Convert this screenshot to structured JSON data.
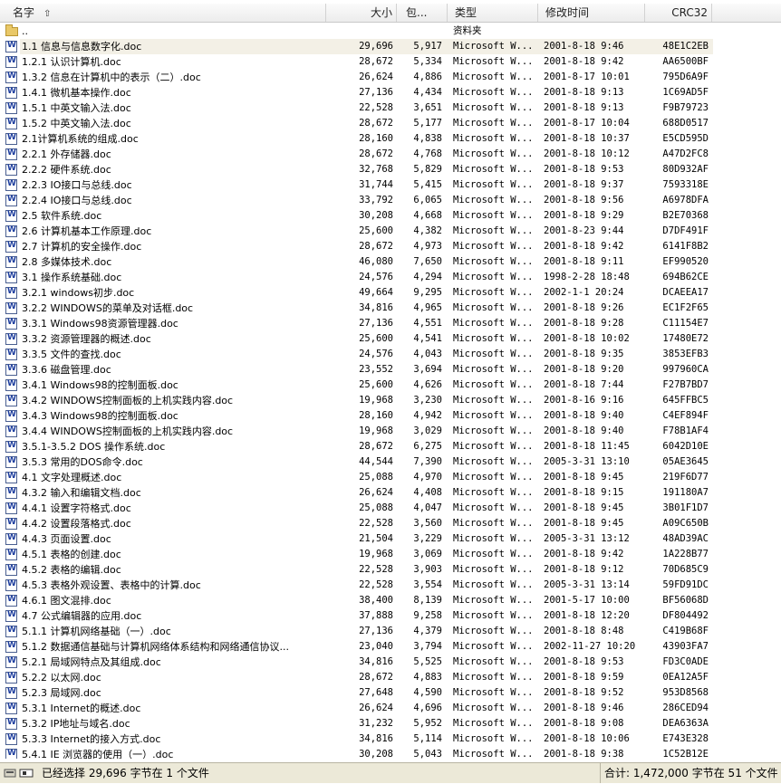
{
  "columns": {
    "name": "名字",
    "size": "大小",
    "packed": "包...",
    "type": "类型",
    "modified": "修改时间",
    "crc": "CRC32"
  },
  "parent_row": {
    "name": "..",
    "type": "资料夹"
  },
  "files": [
    {
      "name": "1.1 信息与信息数字化.doc",
      "size": "29,696",
      "packed": "5,917",
      "type": "Microsoft W...",
      "modified": "2001-8-18 9:46",
      "crc": "48E1C2EB",
      "selected": true
    },
    {
      "name": "1.2.1 认识计算机.doc",
      "size": "28,672",
      "packed": "5,334",
      "type": "Microsoft W...",
      "modified": "2001-8-18 9:42",
      "crc": "AA6500BF"
    },
    {
      "name": "1.3.2 信息在计算机中的表示（二）.doc",
      "size": "26,624",
      "packed": "4,886",
      "type": "Microsoft W...",
      "modified": "2001-8-17 10:01",
      "crc": "795D6A9F"
    },
    {
      "name": "1.4.1 微机基本操作.doc",
      "size": "27,136",
      "packed": "4,434",
      "type": "Microsoft W...",
      "modified": "2001-8-18 9:13",
      "crc": "1C69AD5F"
    },
    {
      "name": "1.5.1 中英文输入法.doc",
      "size": "22,528",
      "packed": "3,651",
      "type": "Microsoft W...",
      "modified": "2001-8-18 9:13",
      "crc": "F9B79723"
    },
    {
      "name": "1.5.2 中英文输入法.doc",
      "size": "28,672",
      "packed": "5,177",
      "type": "Microsoft W...",
      "modified": "2001-8-17 10:04",
      "crc": "688D0517"
    },
    {
      "name": "2.1计算机系统的组成.doc",
      "size": "28,160",
      "packed": "4,838",
      "type": "Microsoft W...",
      "modified": "2001-8-18 10:37",
      "crc": "E5CD595D"
    },
    {
      "name": "2.2.1 外存储器.doc",
      "size": "28,672",
      "packed": "4,768",
      "type": "Microsoft W...",
      "modified": "2001-8-18 10:12",
      "crc": "A47D2FC8"
    },
    {
      "name": "2.2.2 硬件系统.doc",
      "size": "32,768",
      "packed": "5,829",
      "type": "Microsoft W...",
      "modified": "2001-8-18 9:53",
      "crc": "80D932AF"
    },
    {
      "name": "2.2.3 IO接口与总线.doc",
      "size": "31,744",
      "packed": "5,415",
      "type": "Microsoft W...",
      "modified": "2001-8-18 9:37",
      "crc": "7593318E"
    },
    {
      "name": "2.2.4 IO接口与总线.doc",
      "size": "33,792",
      "packed": "6,065",
      "type": "Microsoft W...",
      "modified": "2001-8-18 9:56",
      "crc": "A6978DFA"
    },
    {
      "name": "2.5 软件系统.doc",
      "size": "30,208",
      "packed": "4,668",
      "type": "Microsoft W...",
      "modified": "2001-8-18 9:29",
      "crc": "B2E70368"
    },
    {
      "name": "2.6 计算机基本工作原理.doc",
      "size": "25,600",
      "packed": "4,382",
      "type": "Microsoft W...",
      "modified": "2001-8-23 9:44",
      "crc": "D7DF491F"
    },
    {
      "name": "2.7 计算机的安全操作.doc",
      "size": "28,672",
      "packed": "4,973",
      "type": "Microsoft W...",
      "modified": "2001-8-18 9:42",
      "crc": "6141F8B2"
    },
    {
      "name": "2.8 多媒体技术.doc",
      "size": "46,080",
      "packed": "7,650",
      "type": "Microsoft W...",
      "modified": "2001-8-18 9:11",
      "crc": "EF990520"
    },
    {
      "name": "3.1 操作系统基础.doc",
      "size": "24,576",
      "packed": "4,294",
      "type": "Microsoft W...",
      "modified": "1998-2-28 18:48",
      "crc": "694B62CE"
    },
    {
      "name": "3.2.1 windows初步.doc",
      "size": "49,664",
      "packed": "9,295",
      "type": "Microsoft W...",
      "modified": "2002-1-1 20:24",
      "crc": "DCAEEA17"
    },
    {
      "name": "3.2.2 WINDOWS的菜单及对话框.doc",
      "size": "34,816",
      "packed": "4,965",
      "type": "Microsoft W...",
      "modified": "2001-8-18 9:26",
      "crc": "EC1F2F65"
    },
    {
      "name": "3.3.1 Windows98资源管理器.doc",
      "size": "27,136",
      "packed": "4,551",
      "type": "Microsoft W...",
      "modified": "2001-8-18 9:28",
      "crc": "C11154E7"
    },
    {
      "name": "3.3.2 资源管理器的概述.doc",
      "size": "25,600",
      "packed": "4,541",
      "type": "Microsoft W...",
      "modified": "2001-8-18 10:02",
      "crc": "17480E72"
    },
    {
      "name": "3.3.5 文件的查找.doc",
      "size": "24,576",
      "packed": "4,043",
      "type": "Microsoft W...",
      "modified": "2001-8-18 9:35",
      "crc": "3853EFB3"
    },
    {
      "name": "3.3.6 磁盘管理.doc",
      "size": "23,552",
      "packed": "3,694",
      "type": "Microsoft W...",
      "modified": "2001-8-18 9:20",
      "crc": "997960CA"
    },
    {
      "name": "3.4.1 Windows98的控制面板.doc",
      "size": "25,600",
      "packed": "4,626",
      "type": "Microsoft W...",
      "modified": "2001-8-18 7:44",
      "crc": "F27B7BD7"
    },
    {
      "name": "3.4.2 WINDOWS控制面板的上机实践内容.doc",
      "size": "19,968",
      "packed": "3,230",
      "type": "Microsoft W...",
      "modified": "2001-8-16 9:16",
      "crc": "645FFBC5"
    },
    {
      "name": "3.4.3 Windows98的控制面板.doc",
      "size": "28,160",
      "packed": "4,942",
      "type": "Microsoft W...",
      "modified": "2001-8-18 9:40",
      "crc": "C4EF894F"
    },
    {
      "name": "3.4.4  WINDOWS控制面板的上机实践内容.doc",
      "size": "19,968",
      "packed": "3,029",
      "type": "Microsoft W...",
      "modified": "2001-8-18 9:40",
      "crc": "F78B1AF4"
    },
    {
      "name": "3.5.1-3.5.2  DOS 操作系统.doc",
      "size": "28,672",
      "packed": "6,275",
      "type": "Microsoft W...",
      "modified": "2001-8-18 11:45",
      "crc": "6042D10E"
    },
    {
      "name": "3.5.3 常用的DOS命令.doc",
      "size": "44,544",
      "packed": "7,390",
      "type": "Microsoft W...",
      "modified": "2005-3-31 13:10",
      "crc": "05AE3645"
    },
    {
      "name": "4.1 文字处理概述.doc",
      "size": "25,088",
      "packed": "4,970",
      "type": "Microsoft W...",
      "modified": "2001-8-18 9:45",
      "crc": "219F6D77"
    },
    {
      "name": "4.3.2 输入和编辑文档.doc",
      "size": "26,624",
      "packed": "4,408",
      "type": "Microsoft W...",
      "modified": "2001-8-18 9:15",
      "crc": "191180A7"
    },
    {
      "name": "4.4.1 设置字符格式.doc",
      "size": "25,088",
      "packed": "4,047",
      "type": "Microsoft W...",
      "modified": "2001-8-18 9:45",
      "crc": "3B01F1D7"
    },
    {
      "name": "4.4.2 设置段落格式.doc",
      "size": "22,528",
      "packed": "3,560",
      "type": "Microsoft W...",
      "modified": "2001-8-18 9:45",
      "crc": "A09C650B"
    },
    {
      "name": "4.4.3 页面设置.doc",
      "size": "21,504",
      "packed": "3,229",
      "type": "Microsoft W...",
      "modified": "2005-3-31 13:12",
      "crc": "48AD39AC"
    },
    {
      "name": "4.5.1 表格的创建.doc",
      "size": "19,968",
      "packed": "3,069",
      "type": "Microsoft W...",
      "modified": "2001-8-18 9:42",
      "crc": "1A228B77"
    },
    {
      "name": "4.5.2 表格的编辑.doc",
      "size": "22,528",
      "packed": "3,903",
      "type": "Microsoft W...",
      "modified": "2001-8-18 9:12",
      "crc": "70D685C9"
    },
    {
      "name": "4.5.3 表格外观设置、表格中的计算.doc",
      "size": "22,528",
      "packed": "3,554",
      "type": "Microsoft W...",
      "modified": "2005-3-31 13:14",
      "crc": "59FD91DC"
    },
    {
      "name": "4.6.1 图文混排.doc",
      "size": "38,400",
      "packed": "8,139",
      "type": "Microsoft W...",
      "modified": "2001-5-17 10:00",
      "crc": "BF56068D"
    },
    {
      "name": "4.7 公式编辑器的应用.doc",
      "size": "37,888",
      "packed": "9,258",
      "type": "Microsoft W...",
      "modified": "2001-8-18 12:20",
      "crc": "DF804492"
    },
    {
      "name": "5.1.1 计算机网络基础（一）.doc",
      "size": "27,136",
      "packed": "4,379",
      "type": "Microsoft W...",
      "modified": "2001-8-18 8:48",
      "crc": "C419B68F"
    },
    {
      "name": "5.1.2 数据通信基础与计算机网络体系结构和网络通信协议...",
      "size": "23,040",
      "packed": "3,794",
      "type": "Microsoft W...",
      "modified": "2002-11-27 10:20",
      "crc": "43903FA7"
    },
    {
      "name": "5.2.1 局域网特点及其组成.doc",
      "size": "34,816",
      "packed": "5,525",
      "type": "Microsoft W...",
      "modified": "2001-8-18 9:53",
      "crc": "FD3C0ADE"
    },
    {
      "name": "5.2.2 以太网.doc",
      "size": "28,672",
      "packed": "4,883",
      "type": "Microsoft W...",
      "modified": "2001-8-18 9:59",
      "crc": "0EA12A5F"
    },
    {
      "name": "5.2.3 局域网.doc",
      "size": "27,648",
      "packed": "4,590",
      "type": "Microsoft W...",
      "modified": "2001-8-18 9:52",
      "crc": "953D8568"
    },
    {
      "name": "5.3.1 Internet的概述.doc",
      "size": "26,624",
      "packed": "4,696",
      "type": "Microsoft W...",
      "modified": "2001-8-18 9:46",
      "crc": "286CED94"
    },
    {
      "name": "5.3.2 IP地址与域名.doc",
      "size": "31,232",
      "packed": "5,952",
      "type": "Microsoft W...",
      "modified": "2001-8-18 9:08",
      "crc": "DEA6363A"
    },
    {
      "name": "5.3.3 Internet的接入方式.doc",
      "size": "34,816",
      "packed": "5,114",
      "type": "Microsoft W...",
      "modified": "2001-8-18 10:06",
      "crc": "E743E328"
    },
    {
      "name": "5.4.1 IE 浏览器的使用（一）.doc",
      "size": "30,208",
      "packed": "5,043",
      "type": "Microsoft W...",
      "modified": "2001-8-18 9:38",
      "crc": "1C52B12E"
    }
  ],
  "status": {
    "selection": "已经选择 29,696 字节在 1 个文件",
    "total": "合计: 1,472,000 字节在 51 个文件"
  }
}
